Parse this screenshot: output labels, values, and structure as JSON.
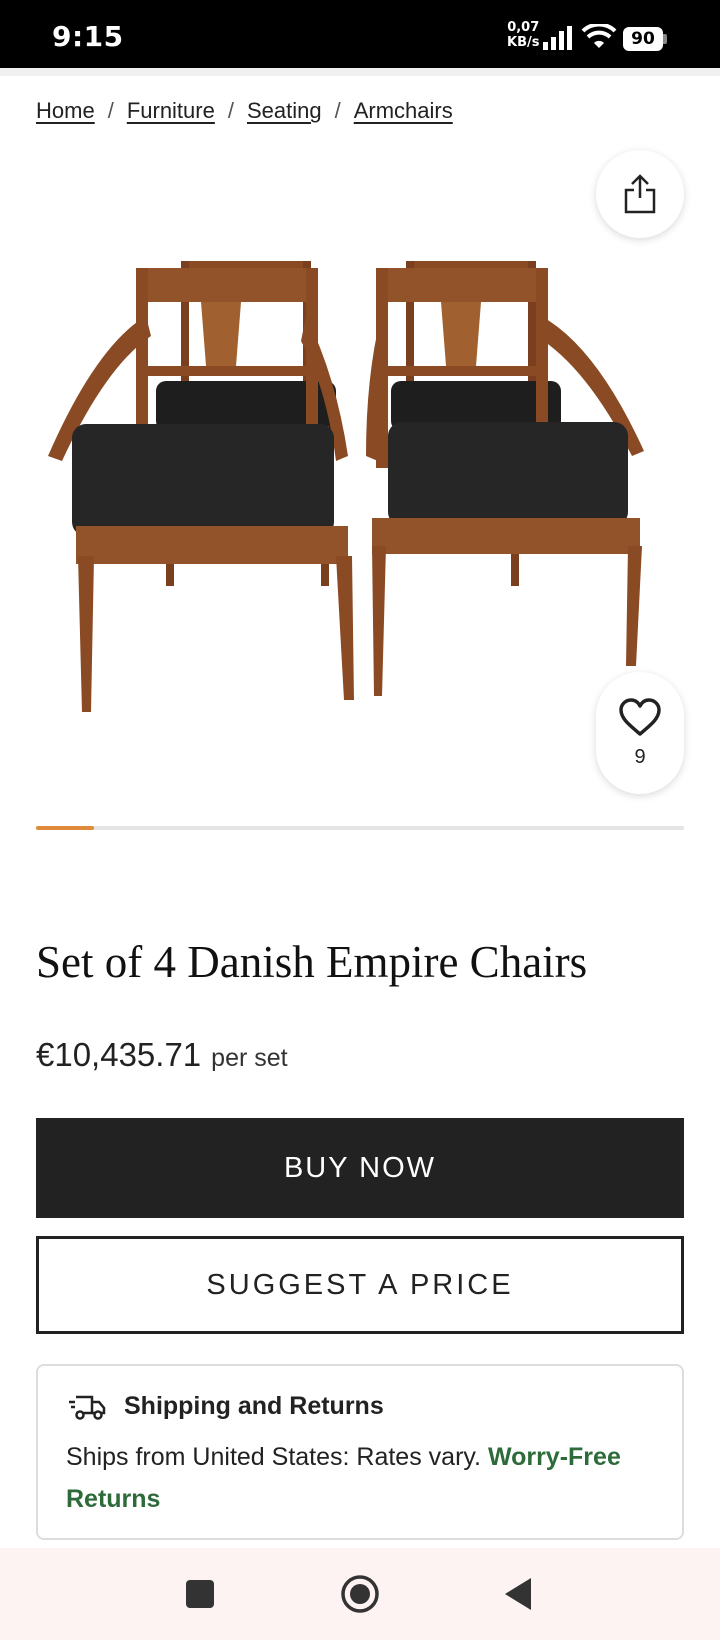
{
  "status_bar": {
    "time": "9:15",
    "net_speed_value": "0,07",
    "net_speed_unit": "KB/s",
    "battery": "90"
  },
  "breadcrumb": {
    "items": [
      "Home",
      "Furniture",
      "Seating",
      "Armchairs"
    ],
    "separator": "/"
  },
  "gallery": {
    "image_alt": "Set of 4 Danish Empire Chairs",
    "favorite_count": "9",
    "image_position": 1,
    "progress_fraction": 0.09,
    "accent_color": "#e08a3c"
  },
  "product": {
    "title": "Set of 4 Danish Empire Chairs",
    "price": "€10,435.71",
    "price_unit": "per set"
  },
  "actions": {
    "buy_label": "BUY NOW",
    "offer_label": "SUGGEST A PRICE"
  },
  "shipping": {
    "title": "Shipping and Returns",
    "text": "Ships from United States: Rates vary.",
    "returns_link": "Worry-Free Returns",
    "link_color": "#2e6b3a"
  },
  "icons": {
    "share": "share-icon",
    "favorite": "heart-icon",
    "shipping": "truck-icon",
    "nav_recents": "square-icon",
    "nav_home": "circle-icon",
    "nav_back": "triangle-back-icon"
  }
}
